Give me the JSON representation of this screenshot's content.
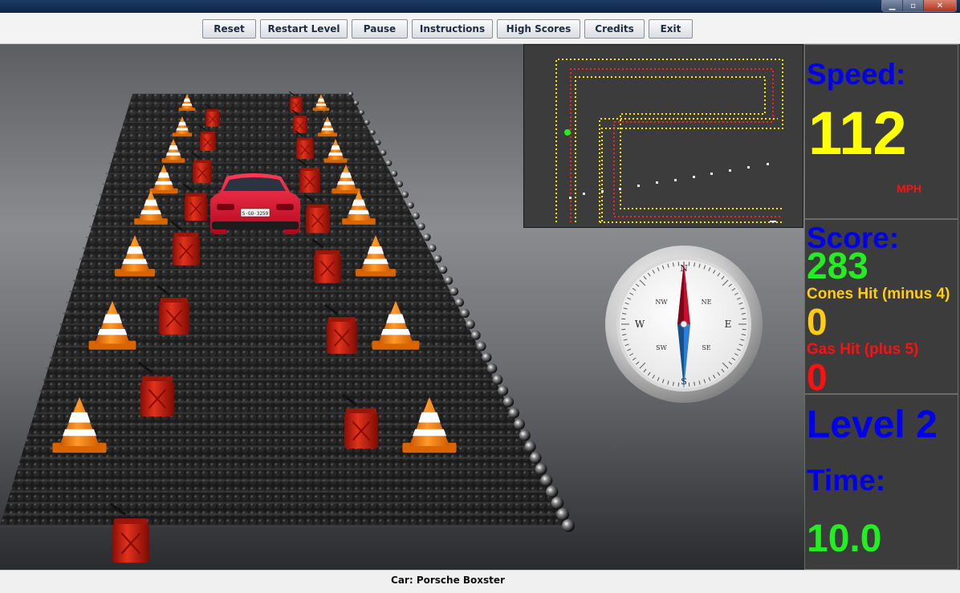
{
  "window": {
    "minimize_glyph": "▁",
    "maximize_glyph": "▫",
    "close_glyph": "✕"
  },
  "toolbar": {
    "buttons": [
      "Reset",
      "Restart Level",
      "Pause",
      "Instructions",
      "High Scores",
      "Credits",
      "Exit"
    ]
  },
  "hud": {
    "speed_label": "Speed:",
    "speed_value": "112",
    "speed_unit": "MPH",
    "score_label": "Score:",
    "score_value": "283",
    "cones_label": "Cones Hit (minus 4)",
    "cones_value": "0",
    "gas_label": "Gas Hit (plus 5)",
    "gas_value": "0",
    "level_label": "Level 2",
    "time_label": "Time:",
    "time_value": "10.0"
  },
  "compass": {
    "directions": {
      "n": "N",
      "s": "S",
      "e": "E",
      "w": "W",
      "nw": "NW",
      "ne": "NE",
      "sw": "SW",
      "se": "SE"
    }
  },
  "car": {
    "plate": "S·GO·3259"
  },
  "status": {
    "car_label": "Car: Porsche Boxster"
  },
  "colors": {
    "speed_label": "#0000ee",
    "speed_value": "#ffff00",
    "mph": "#ff1010",
    "score_value": "#22ee22",
    "cones": "#ffcc11",
    "gas": "#ff1010",
    "panel_bg": "#3c3c3c",
    "cone_orange": "#ff7a00",
    "gas_can_red": "#c21a0c",
    "minimap_yellow": "#ffe600",
    "minimap_red": "#ff2020",
    "minimap_player": "#22ee22"
  }
}
